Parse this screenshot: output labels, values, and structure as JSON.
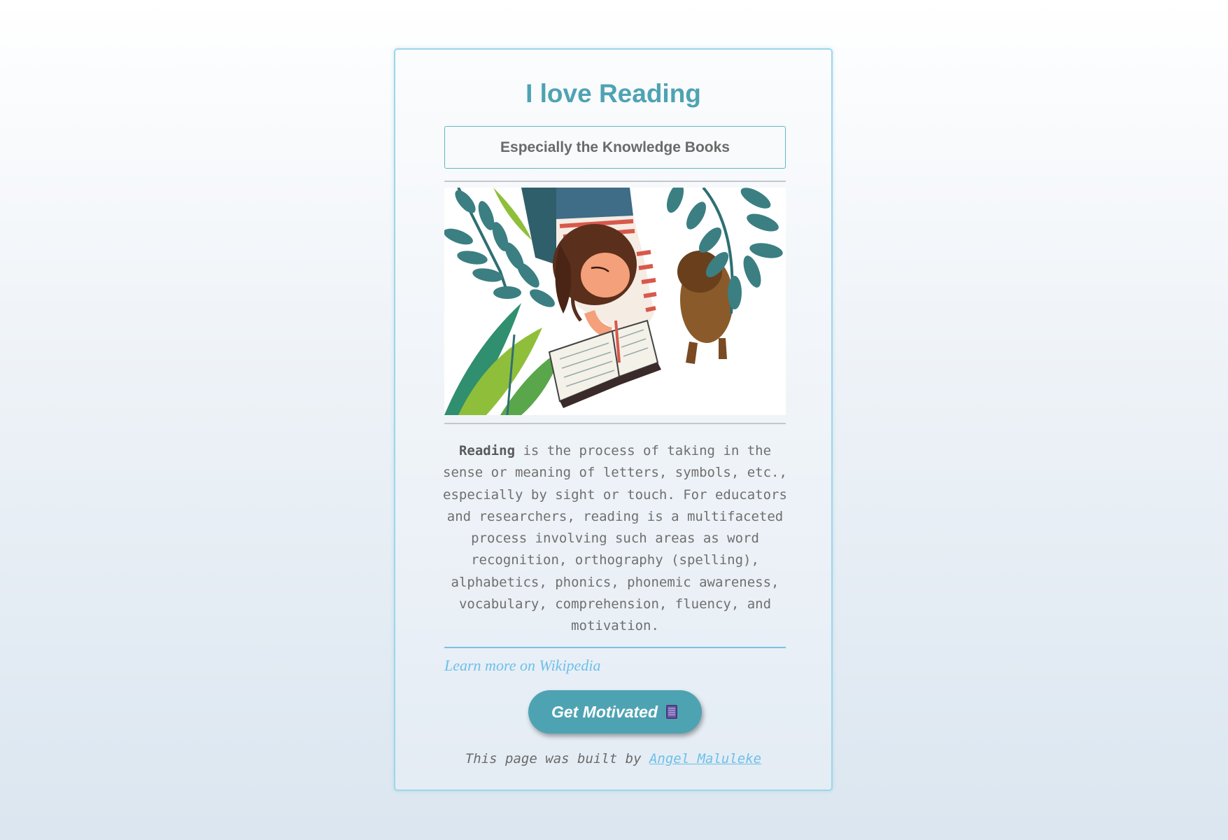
{
  "page": {
    "title": "I love Reading",
    "subtitle": "Especially the Knowledge Books",
    "description": {
      "bold_lead": "Reading",
      "text": " is the process of taking in the sense or meaning of letters, symbols, etc., especially by sight or touch. For educators and researchers, reading is a multifaceted process involving such areas as word recognition, orthography (spelling), alphabetics, phonics, phonemic awareness, vocabulary, comprehension, fluency, and motivation."
    },
    "wiki_link": "Learn more on Wikipedia",
    "button_label": "Get Motivated",
    "button_icon": "book-icon",
    "footer_prefix": "This page was built by ",
    "footer_author": "Angel Maluleke"
  },
  "colors": {
    "accent": "#4ea3b3",
    "link": "#6cc0ea",
    "card_border": "#9dd6ea",
    "text": "#6f6f6f"
  }
}
